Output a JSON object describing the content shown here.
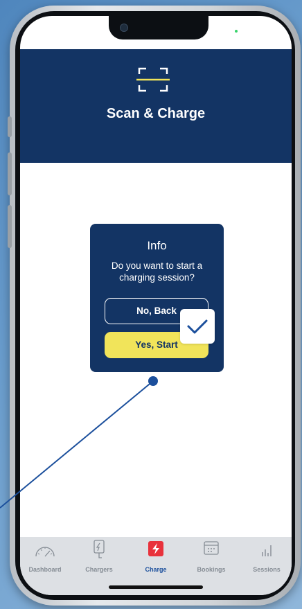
{
  "header": {
    "title": "Scan & Charge",
    "icon": "scan-icon"
  },
  "dialog": {
    "title": "Info",
    "message": "Do you want to start a charging session?",
    "back_label": "No, Back",
    "start_label": "Yes, Start"
  },
  "tabs": [
    {
      "label": "Dashboard",
      "icon": "speedometer-icon",
      "active": false
    },
    {
      "label": "Chargers",
      "icon": "charger-icon",
      "active": false
    },
    {
      "label": "Charge",
      "icon": "bolt-icon",
      "active": true
    },
    {
      "label": "Bookings",
      "icon": "calendar-icon",
      "active": false
    },
    {
      "label": "Sessions",
      "icon": "bar-chart-icon",
      "active": false
    }
  ],
  "colors": {
    "primary": "#133464",
    "accent_yellow": "#f1e45a",
    "active_tab": "#1b4f9c",
    "charge_red": "#e8323c",
    "background": "#6a9dcd"
  }
}
